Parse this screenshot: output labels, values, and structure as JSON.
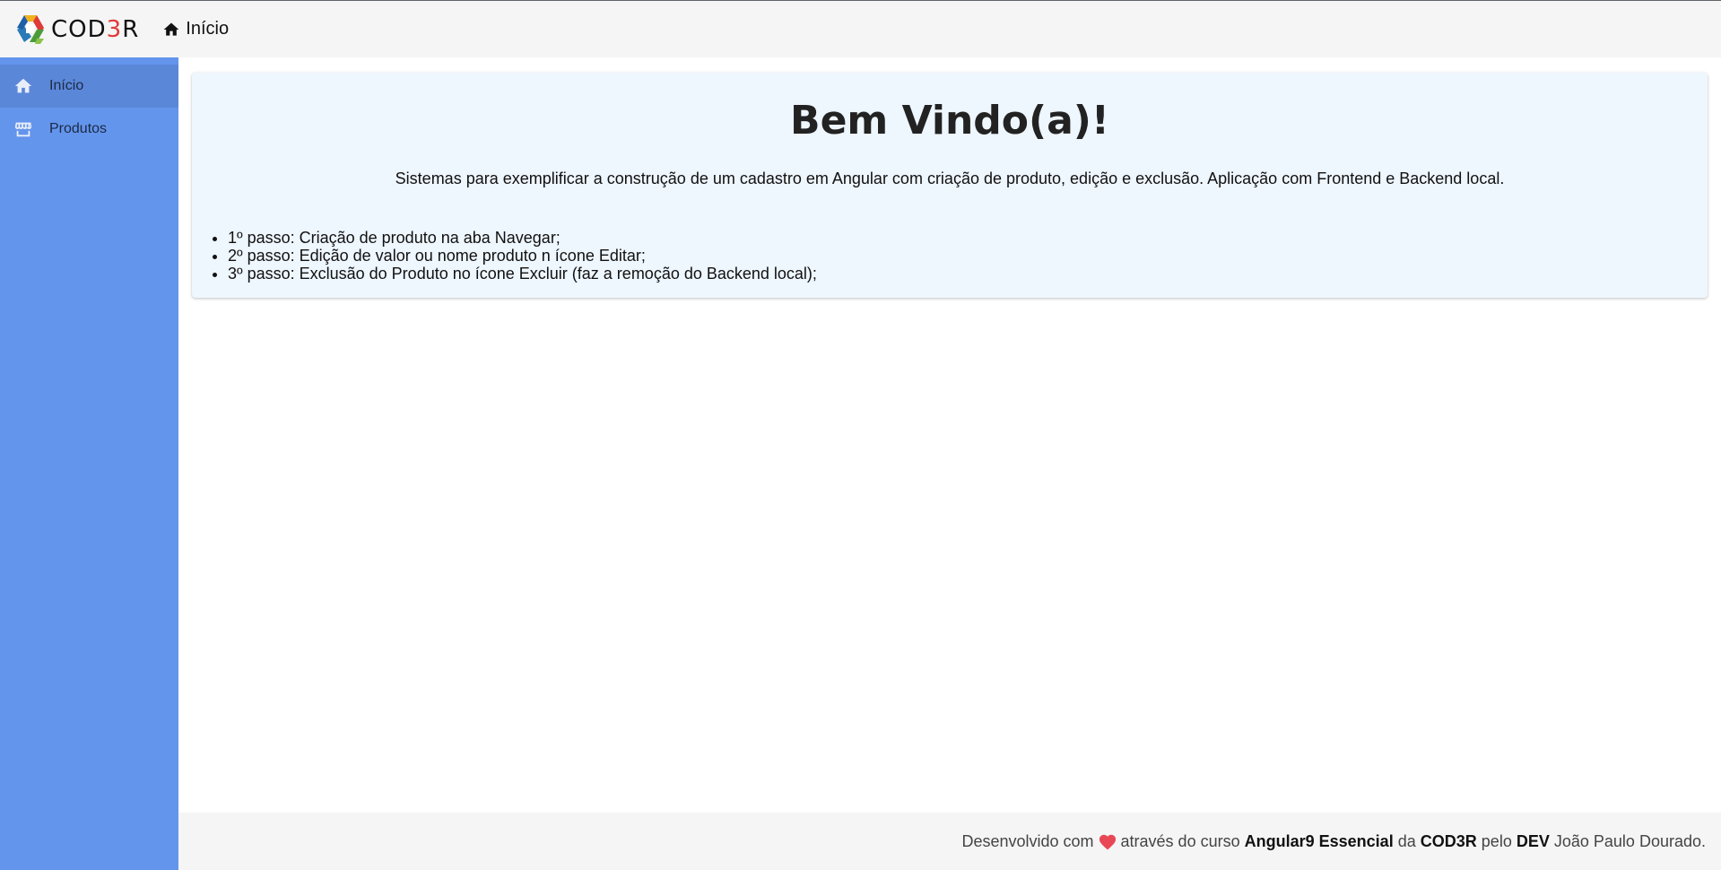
{
  "colors": {
    "sidebar_bg": "#6495ed",
    "sidebar_active_bg": "#5b87d9",
    "card_bg": "#eef6fe",
    "header_bg": "#f5f5f5",
    "heart": "#e84855"
  },
  "header": {
    "logo_text_a": "COD",
    "logo_text_b": "3",
    "logo_text_c": "R",
    "home_icon": "home-icon",
    "title": "Início"
  },
  "sidebar": {
    "items": [
      {
        "label": "Início",
        "icon": "home-icon",
        "active": true
      },
      {
        "label": "Produtos",
        "icon": "store-icon",
        "active": false
      }
    ]
  },
  "main": {
    "title": "Bem Vindo(a)!",
    "description": "Sistemas para exemplificar a construção de um cadastro em Angular com criação de produto, edição e exclusão. Aplicação com Frontend e Backend local.",
    "steps": [
      "1º passo: Criação de produto na aba Navegar;",
      "2º passo: Edição de valor ou nome produto n ícone Editar;",
      "3º passo: Exclusão do Produto no ícone Excluir (faz a remoção do Backend local);"
    ]
  },
  "footer": {
    "part1": "Desenvolvido com",
    "heart_icon": "heart-icon",
    "part2": "através do curso",
    "course": "Angular9 Essencial",
    "part3": "da",
    "brand": "COD3R",
    "part4": "pelo",
    "dev": "DEV",
    "author": "João Paulo Dourado."
  }
}
